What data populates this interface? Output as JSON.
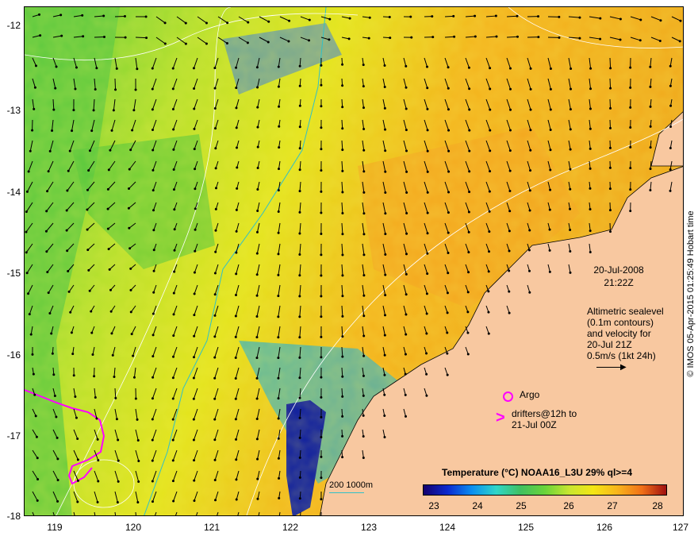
{
  "map": {
    "date": "20-Jul-2008",
    "time": "21:22Z",
    "altimetry_lines": [
      "Altimetric sealevel",
      "(0.1m contours)",
      "and velocity for",
      "20-Jul 21Z",
      "0.5m/s (1kt 24h)"
    ],
    "argo_label": "Argo",
    "drifters_lines": [
      "drifters@12h to",
      "21-Jul 00Z"
    ],
    "colorbar_title": "Temperature (°C) NOAA16_L3U 29% ql>=4",
    "colorbar_ticks": [
      "23",
      "24",
      "25",
      "26",
      "27",
      "28"
    ],
    "scale_label": "200  1000m",
    "credit": "© IMOS 05-Apr-2015 01:25:49 Hobart time",
    "lat_ticks": [
      "-12",
      "-13",
      "-14",
      "-15",
      "-16",
      "-17",
      "-18"
    ],
    "lon_ticks": [
      "119",
      "120",
      "121",
      "122",
      "123",
      "124",
      "125",
      "126",
      "127"
    ],
    "lat_range": [
      -18,
      -11.8
    ],
    "lon_range": [
      118.6,
      127
    ],
    "colors": {
      "land": "#f8c8a0",
      "argo": "#ff00ff",
      "drifter": "#ff00ff",
      "contour_200m": "#30c0c8",
      "sealevel_contour": "#ffffff"
    },
    "colorbar_range": [
      22.6,
      28.2
    ]
  }
}
